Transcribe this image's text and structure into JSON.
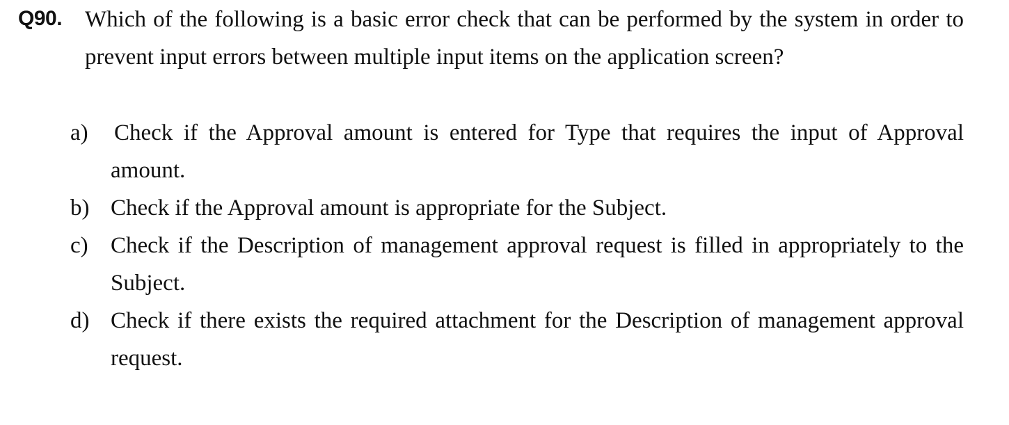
{
  "question": {
    "number": "Q90.",
    "text": "Which of the following is a basic error check that can be performed by the system in order to prevent input errors between multiple input items on the application screen?"
  },
  "options": [
    {
      "letter": "a)",
      "text": "Check if the Approval amount is entered for Type that requires the input of Approval amount."
    },
    {
      "letter": "b)",
      "text": "Check if the Approval amount is appropriate for the Subject."
    },
    {
      "letter": "c)",
      "text": "Check if the Description of management approval request is filled in appropriately to the Subject."
    },
    {
      "letter": "d)",
      "text": "Check if there exists the required attachment for the Description of management approval request."
    }
  ]
}
